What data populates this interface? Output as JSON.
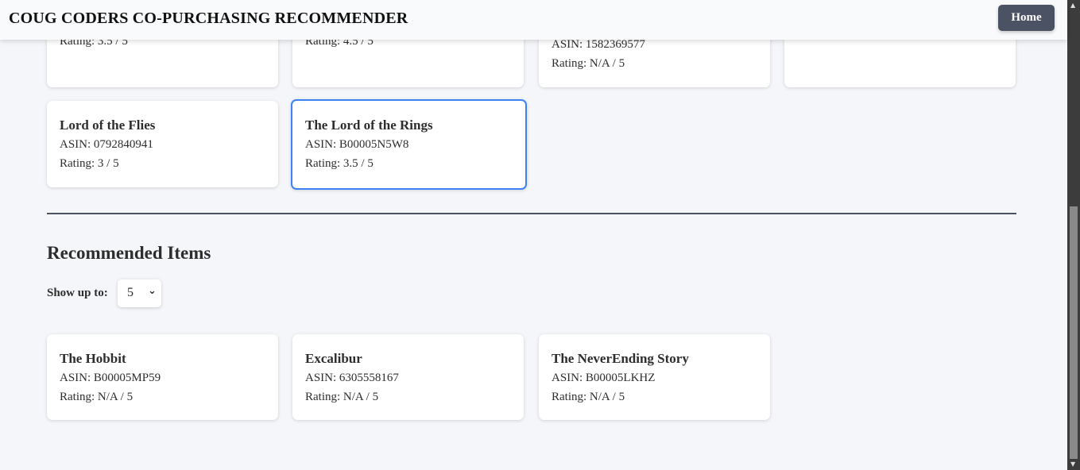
{
  "header": {
    "title": "COUG CODERS CO-PURCHASING RECOMMENDER",
    "home_label": "Home"
  },
  "selected_items": [
    {
      "rating": "Rating: 3.5 / 5"
    },
    {
      "rating": "Rating: 4.5 / 5"
    },
    {
      "asin": "ASIN: 1582369577",
      "rating": "Rating: N/A / 5"
    },
    {},
    {
      "title": "Lord of the Flies",
      "asin": "ASIN: 0792840941",
      "rating": "Rating: 3 / 5"
    },
    {
      "title": "The Lord of the Rings",
      "asin": "ASIN: B00005N5W8",
      "rating": "Rating: 3.5 / 5"
    }
  ],
  "recommended": {
    "heading": "Recommended Items",
    "show_label": "Show up to:",
    "show_value": "5",
    "items": [
      {
        "title": "The Hobbit",
        "asin": "ASIN: B00005MP59",
        "rating": "Rating: N/A / 5"
      },
      {
        "title": "Excalibur",
        "asin": "ASIN: 6305558167",
        "rating": "Rating: N/A / 5"
      },
      {
        "title": "The NeverEnding Story",
        "asin": "ASIN: B00005LKHZ",
        "rating": "Rating: N/A / 5"
      }
    ]
  }
}
